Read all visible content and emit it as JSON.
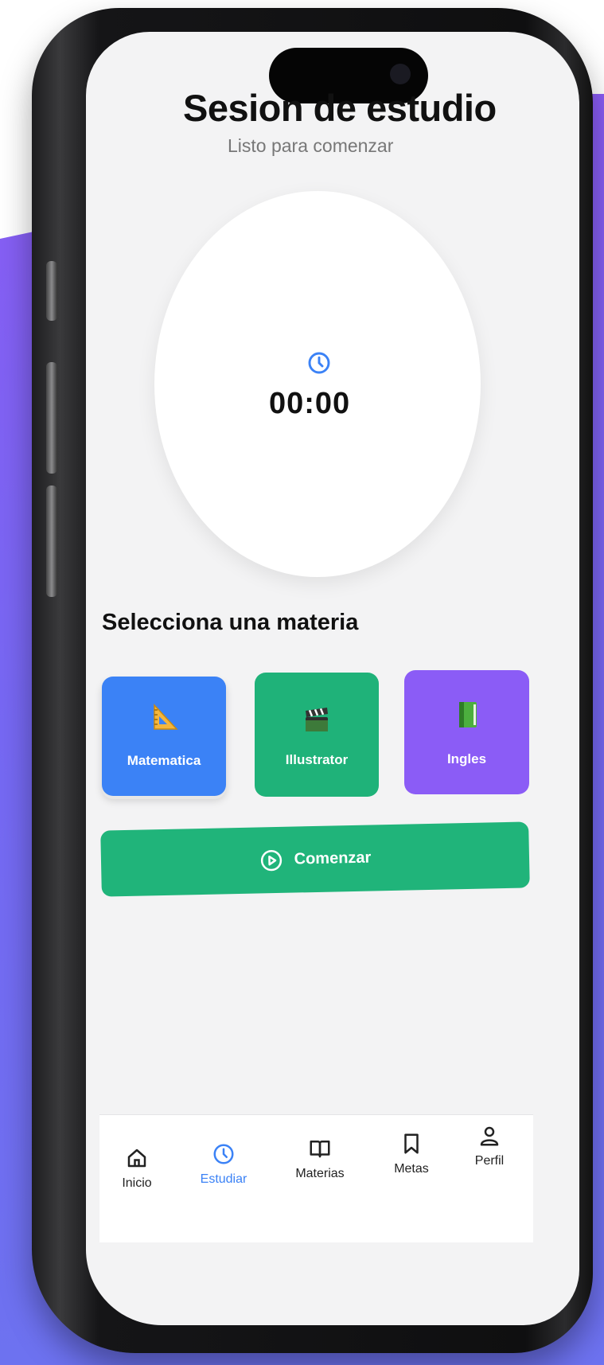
{
  "header": {
    "title": "Sesion de estudio",
    "subtitle": "Listo para comenzar"
  },
  "timer": {
    "icon": "clock-icon",
    "value": "00:00"
  },
  "subjects": {
    "section_title": "Selecciona una materia",
    "items": [
      {
        "label": "Matematica",
        "icon": "triangle-ruler-icon",
        "color": "#3b82f6",
        "selected": true
      },
      {
        "label": "Illustrator",
        "icon": "clapper-board-icon",
        "color": "#1fb279",
        "selected": false
      },
      {
        "label": "Ingles",
        "icon": "green-book-icon",
        "color": "#8b5cf6",
        "selected": false
      }
    ]
  },
  "start_button": {
    "label": "Comenzar",
    "icon": "play-circle-icon",
    "color": "#20b47a"
  },
  "bottom_nav": {
    "items": [
      {
        "label": "Inicio",
        "icon": "home-icon",
        "active": false
      },
      {
        "label": "Estudiar",
        "icon": "clock-icon",
        "active": true
      },
      {
        "label": "Materias",
        "icon": "open-book-icon",
        "active": false
      },
      {
        "label": "Metas",
        "icon": "bookmark-icon",
        "active": false
      },
      {
        "label": "Perfil",
        "icon": "user-icon",
        "active": false
      }
    ]
  },
  "colors": {
    "accent": "#3b82f6",
    "background_gradient_top": "#8a5cf4",
    "background_gradient_bottom": "#6d72f0"
  }
}
